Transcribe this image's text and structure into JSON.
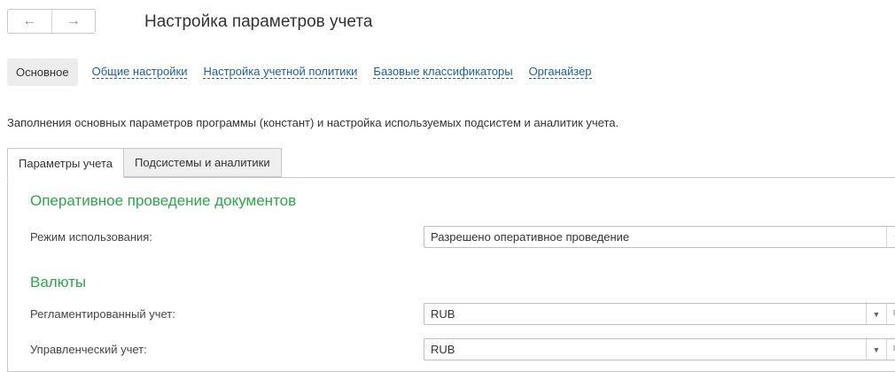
{
  "nav": {
    "back_icon": "arrow-left-icon",
    "forward_icon": "arrow-right-icon",
    "back": "←",
    "forward": "→"
  },
  "page_title": "Настройка параметров учета",
  "section_tabs": [
    {
      "label": "Основное",
      "active": true
    },
    {
      "label": "Общие настройки",
      "active": false
    },
    {
      "label": "Настройка учетной политики",
      "active": false
    },
    {
      "label": "Базовые классификаторы",
      "active": false
    },
    {
      "label": "Органайзер",
      "active": false
    }
  ],
  "description": "Заполнения основных параметров программы (констант) и настройка используемых подсистем и аналитик учета.",
  "tabs": [
    {
      "label": "Параметры учета",
      "active": true
    },
    {
      "label": "Подсистемы и аналитики",
      "active": false
    }
  ],
  "groups": {
    "posting": {
      "title": "Оперативное проведение документов",
      "mode_label": "Режим использования:",
      "mode_value": "Разрешено оперативное проведение"
    },
    "currencies": {
      "title": "Валюты",
      "regulated_label": "Регламентированный учет:",
      "regulated_value": "RUB",
      "management_label": "Управленческий учет:",
      "management_value": "RUB"
    }
  },
  "icons": {
    "dropdown": "▼",
    "open": "⧉"
  },
  "colors": {
    "link": "#1a5ea8",
    "group_title": "#2aa846",
    "active_tab_bg": "#ececec"
  }
}
